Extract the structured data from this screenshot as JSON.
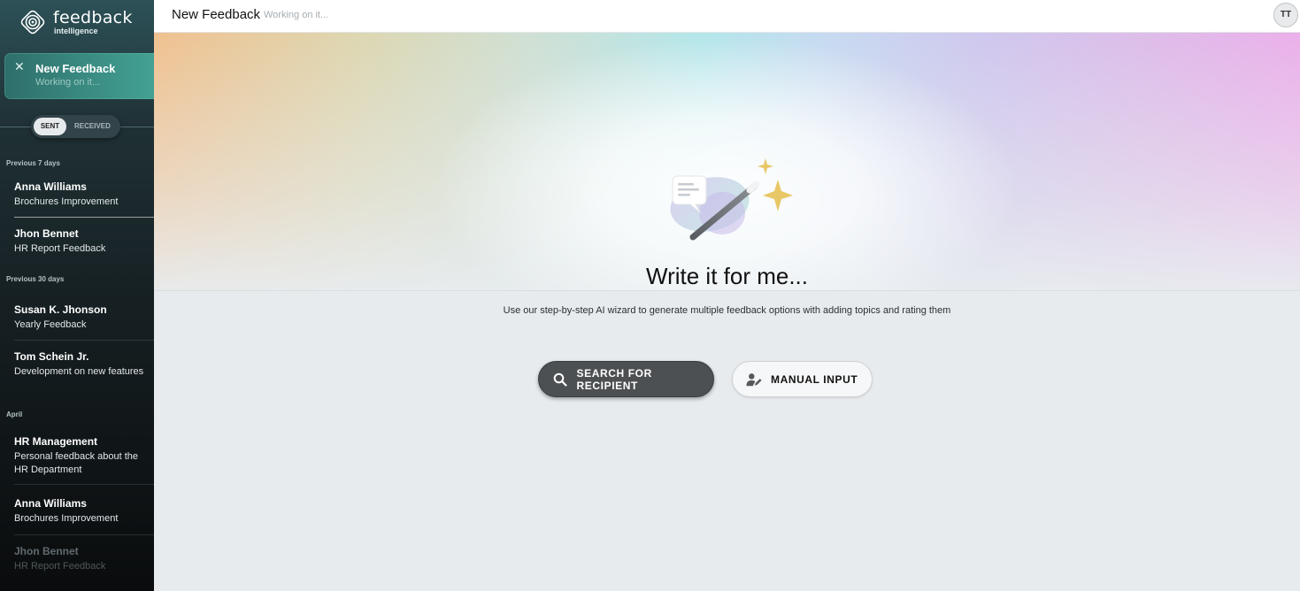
{
  "sidebar": {
    "logo": {
      "word": "feedback",
      "sub": "intelligence"
    },
    "active_item": {
      "title": "New Feedback",
      "status": "Working on it..."
    },
    "toggle": {
      "sent": "SENT",
      "received": "RECEIVED",
      "selected": "SENT"
    },
    "sections": [
      {
        "label": "Previous 7 days"
      },
      {
        "label": "Previous 30 days"
      },
      {
        "label": "April"
      }
    ],
    "items": [
      {
        "name": "Anna Williams",
        "desc": "Brochures Improvement"
      },
      {
        "name": "Jhon Bennet",
        "desc": "HR Report Feedback"
      },
      {
        "name": "Susan K. Jhonson",
        "desc": "Yearly Feedback"
      },
      {
        "name": "Tom Schein Jr.",
        "desc": "Development on new features"
      },
      {
        "name": "HR Management",
        "desc": "Personal feedback about the HR Department"
      },
      {
        "name": "Anna Williams",
        "desc": "Brochures Improvement"
      },
      {
        "name": "Jhon Bennet",
        "desc": "HR Report Feedback"
      }
    ]
  },
  "header": {
    "title": "New Feedback",
    "status": "Working on it...",
    "avatar_initials": "TT"
  },
  "main": {
    "title": "Write it for me...",
    "description": "Use our step-by-step AI wizard to generate multiple feedback options with adding topics and rating them",
    "search_button": "SEARCH FOR RECIPIENT",
    "manual_button": "MANUAL INPUT"
  },
  "colors": {
    "accent_teal": "#3a8c82",
    "sidebar_dark": "#151e21",
    "primary_button": "#4d5052",
    "sparkle_gold": "#e8c766"
  },
  "icons": {
    "logo": "logo-icon",
    "close": "close-icon",
    "search": "search-icon",
    "manual": "user-edit-icon",
    "hero": "magic-wand-icon"
  }
}
